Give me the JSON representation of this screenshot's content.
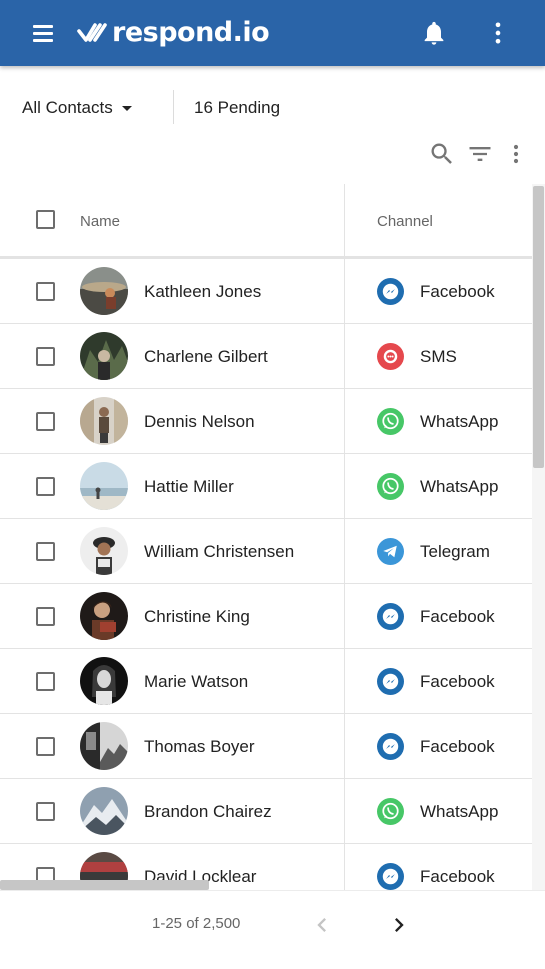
{
  "app": {
    "logo_text": "respond.io",
    "accent": "#2a64a8"
  },
  "filter": {
    "contacts_label": "All Contacts",
    "pending_label": "16 Pending"
  },
  "table": {
    "columns": {
      "name": "Name",
      "channel": "Channel"
    },
    "rows": [
      {
        "name": "Kathleen Jones",
        "channel": "Facebook",
        "channel_icon": "messenger-icon"
      },
      {
        "name": "Charlene Gilbert",
        "channel": "SMS",
        "channel_icon": "sms-icon"
      },
      {
        "name": "Dennis Nelson",
        "channel": "WhatsApp",
        "channel_icon": "whatsapp-icon"
      },
      {
        "name": "Hattie Miller",
        "channel": "WhatsApp",
        "channel_icon": "whatsapp-icon"
      },
      {
        "name": "William Christensen",
        "channel": "Telegram",
        "channel_icon": "telegram-icon"
      },
      {
        "name": "Christine King",
        "channel": "Facebook",
        "channel_icon": "messenger-icon"
      },
      {
        "name": "Marie Watson",
        "channel": "Facebook",
        "channel_icon": "messenger-icon"
      },
      {
        "name": "Thomas Boyer",
        "channel": "Facebook",
        "channel_icon": "messenger-icon"
      },
      {
        "name": "Brandon Chairez",
        "channel": "WhatsApp",
        "channel_icon": "whatsapp-icon"
      },
      {
        "name": "David Locklear",
        "channel": "Facebook",
        "channel_icon": "messenger-icon"
      }
    ]
  },
  "pagination": {
    "range_label": "1-25 of 2,500"
  },
  "colors": {
    "facebook": "#1f6db0",
    "sms": "#e5484d",
    "whatsapp": "#47c767",
    "telegram": "#3b96d8"
  }
}
